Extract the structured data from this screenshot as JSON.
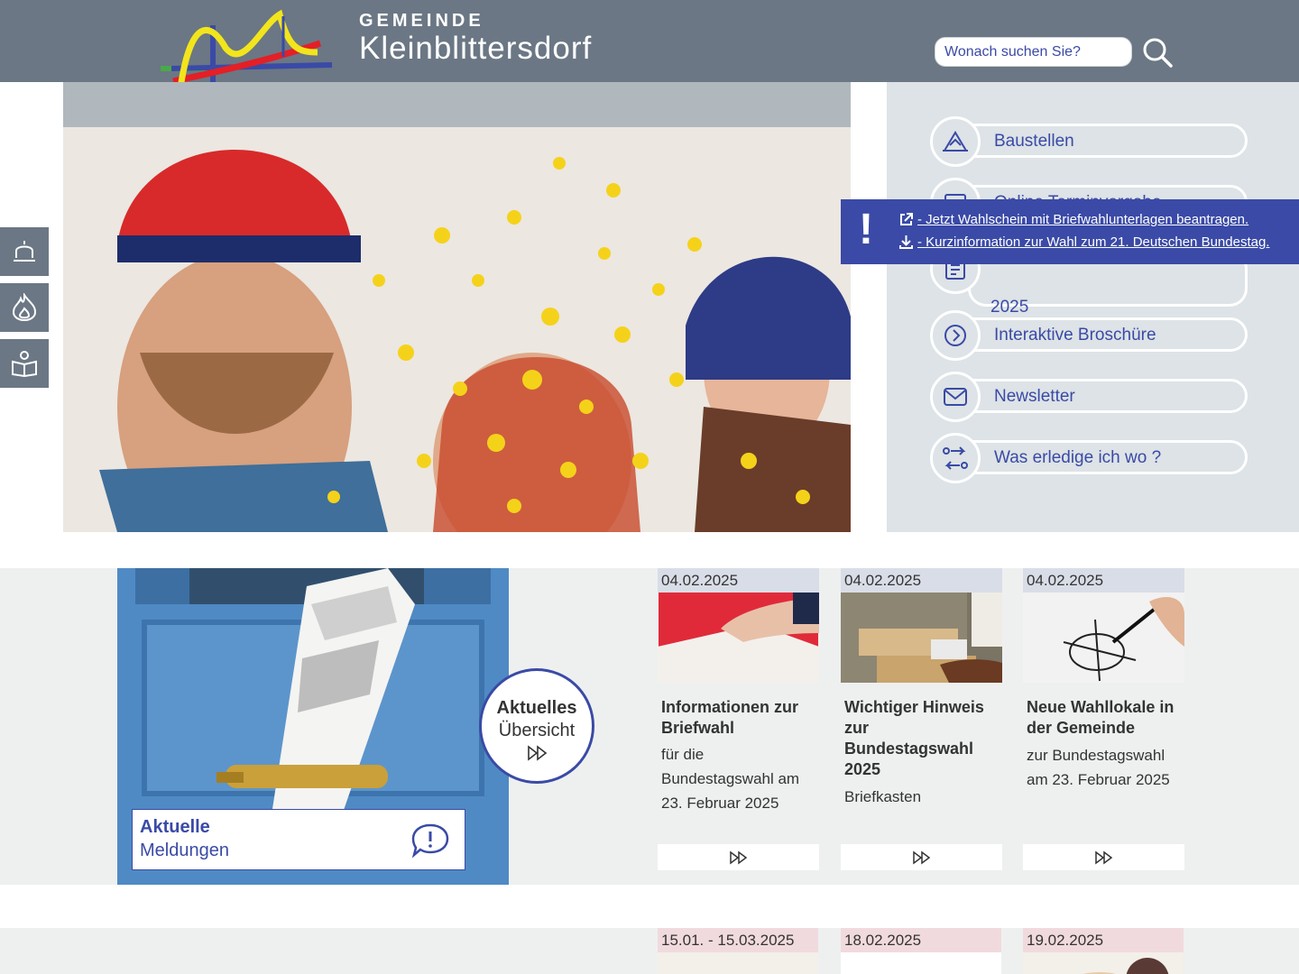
{
  "colors": {
    "header_bg": "#6b7784",
    "panel_bg": "#dde3e6",
    "accent": "#3a4aa6",
    "news_bg": "#eef0f0",
    "event_date_bg": "#f1dadd",
    "news_date_bg": "#d9dde7"
  },
  "header": {
    "brand_small": "GEMEINDE",
    "brand_large": "Kleinblittersdorf",
    "search_placeholder": "Wonach suchen Sie?"
  },
  "quick_links": [
    {
      "label": "Baustellen",
      "icon": "construction-icon"
    },
    {
      "label": "Online Terminvergabe",
      "icon": "calendar-icon"
    },
    {
      "label": "2025",
      "icon": "document-list-icon"
    },
    {
      "label": "Interaktive Broschüre",
      "icon": "chevron-right-circle-icon"
    },
    {
      "label": "Newsletter",
      "icon": "envelope-icon"
    },
    {
      "label": "Was erledige ich wo ?",
      "icon": "route-icon"
    }
  ],
  "alert": {
    "mark": "!",
    "links": [
      {
        "label": "- Jetzt Wahlschein mit Briefwahlunterlagen beantragen.",
        "icon": "external-link-icon"
      },
      {
        "label": "- Kurzinformation zur Wahl zum 21. Deutschen Bundestag.",
        "icon": "download-icon"
      }
    ]
  },
  "side_buttons": [
    {
      "icon": "bell-icon"
    },
    {
      "icon": "flame-icon"
    },
    {
      "icon": "book-reader-icon"
    }
  ],
  "news": {
    "label_bold": "Aktuelle",
    "label_regular": "Meldungen",
    "overview_bold": "Aktuelles",
    "overview_regular": "Übersicht",
    "cards": [
      {
        "date": "04.02.2025",
        "title": "Informationen zur Briefwahl",
        "subtitle": "für die Bundestagswahl am 23. Februar 2025"
      },
      {
        "date": "04.02.2025",
        "title": "Wichtiger Hinweis zur Bundestagswahl 2025",
        "subtitle": "Briefkasten"
      },
      {
        "date": "04.02.2025",
        "title": "Neue Wahllokale in der Gemeinde",
        "subtitle": "zur Bundestagswahl am 23. Februar 2025"
      }
    ]
  },
  "events": [
    {
      "date": "15.01. - 15.03.2025"
    },
    {
      "date": "18.02.2025"
    },
    {
      "date": "19.02.2025"
    }
  ]
}
